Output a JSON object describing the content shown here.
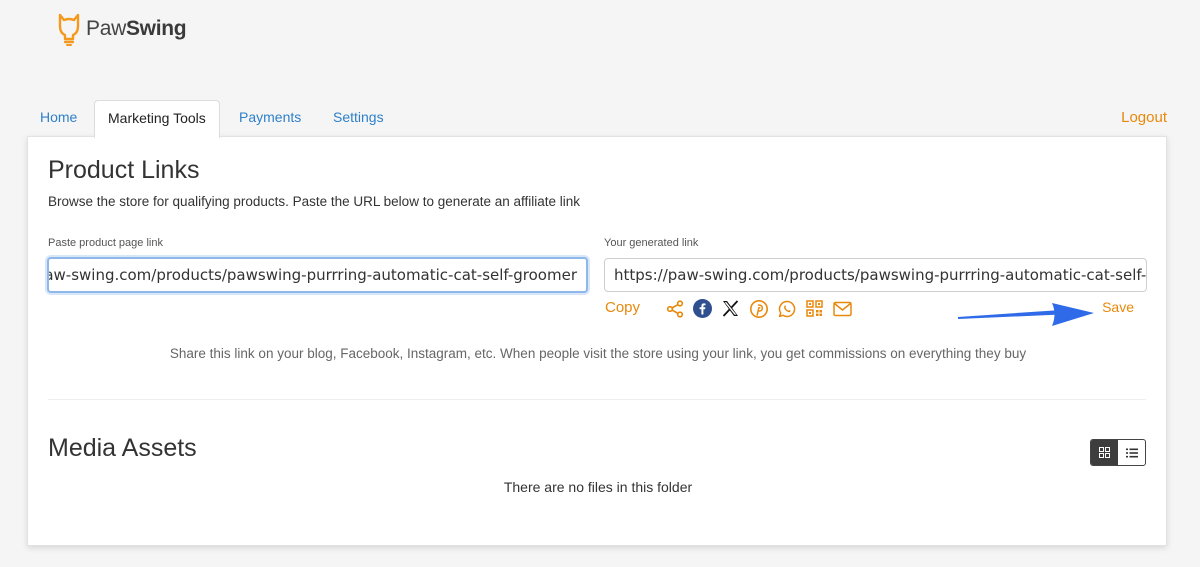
{
  "brand": {
    "name_light": "Paw",
    "name_bold": "Swing"
  },
  "nav": {
    "tabs": [
      {
        "label": "Home"
      },
      {
        "label": "Marketing Tools"
      },
      {
        "label": "Payments"
      },
      {
        "label": "Settings"
      }
    ],
    "logout": "Logout"
  },
  "product_links": {
    "title": "Product Links",
    "description": "Browse the store for qualifying products. Paste the URL below to generate an affiliate link",
    "paste_label": "Paste product page link",
    "paste_value": "https://paw-swing.com/products/pawswing-purrring-automatic-cat-self-groomer",
    "generated_label": "Your generated link",
    "generated_value": "https://paw-swing.com/products/pawswing-purrring-automatic-cat-self-",
    "copy": "Copy",
    "save": "Save",
    "share_note": "Share this link on your blog, Facebook, Instagram, etc. When people visit the store using your link, you get commissions on everything they buy"
  },
  "media_assets": {
    "title": "Media Assets",
    "empty": "There are no files in this folder"
  },
  "colors": {
    "accent": "#e8890b",
    "link": "#2f80c9",
    "arrow": "#2f6be8"
  },
  "icons": [
    "share-icon",
    "facebook-icon",
    "x-icon",
    "pinterest-icon",
    "whatsapp-icon",
    "qr-code-icon",
    "email-icon"
  ]
}
